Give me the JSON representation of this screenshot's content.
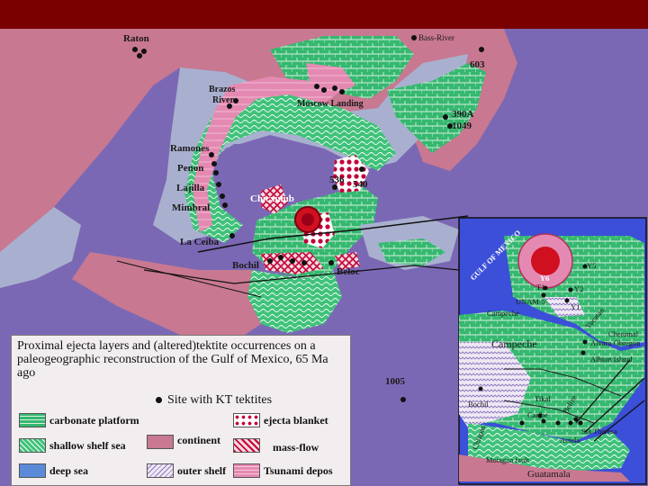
{
  "map": {
    "sites": {
      "raton": "Raton",
      "bass_river": "Bass-River",
      "site_603": "603",
      "brazos_river": [
        "Brazos",
        "River"
      ],
      "moscow_landing": "Moscow Landing",
      "site_390a": "390A",
      "site_1049": "1049",
      "ramones": "Ramones",
      "penon": "Penon",
      "lajilla": "Lajilla",
      "mimbral": "Mimbral",
      "la_ceiba": "La Ceiba",
      "chicxulub": "Chicxulub",
      "site_536": "536",
      "site_540": "540",
      "bochil": "Bochil",
      "beloc": "Beloc",
      "site_1005": "1005"
    },
    "inset": {
      "gulf_of_mexico": "GULF OF MEXICO",
      "y6": "Y6",
      "y5": "Y5",
      "t1": "T1",
      "y2": "Y2",
      "y1": "Y1",
      "unam5": "UNAM-5",
      "campeche_town": "Campeche",
      "campeche_region": "Campeche",
      "yucatan": "Yucatan",
      "chetumal": "Chetumal",
      "alvaro_obregon": "Alvaro Obregon",
      "albion_island": "Albion Island",
      "bochil": "Bochil",
      "tikal": "Tikal",
      "caribe": "Caribe",
      "belize": "Belize",
      "chiapas": "Chiapas",
      "sta_theresa": "Sta Theresa",
      "actela": "Actela",
      "motagua_fault": "Motagua fault",
      "guatamala": "Guatamala"
    }
  },
  "legend": {
    "title": "Proximal ejecta layers and (altered)tektite occurrences on a paleogeographic reconstruction of the Gulf of Mexico, 65 Ma ago",
    "site_key": "Site with KT tektites",
    "items": {
      "carbonate_platform": "carbonate platform",
      "shallow_shelf_sea": "shallow shelf sea",
      "deep_sea": "deep sea",
      "continent": "continent",
      "outer_shelf": "outer shelf",
      "ejecta_blanket": "ejecta blanket",
      "mass_flow": "mass-flow",
      "tsunami_depos": "Tsunami depos"
    }
  },
  "colors": {
    "header_bar": "#7a0000",
    "deep_sea": "#7b68b5",
    "continent": "#c87890",
    "shallow_shelf": "#a9b0cf",
    "carbonate_platform": "#3fc27a",
    "tsunami_deposits": "#e08ab0",
    "ejecta_blanket": "#c2003a",
    "impact_crater": "#d01020"
  }
}
